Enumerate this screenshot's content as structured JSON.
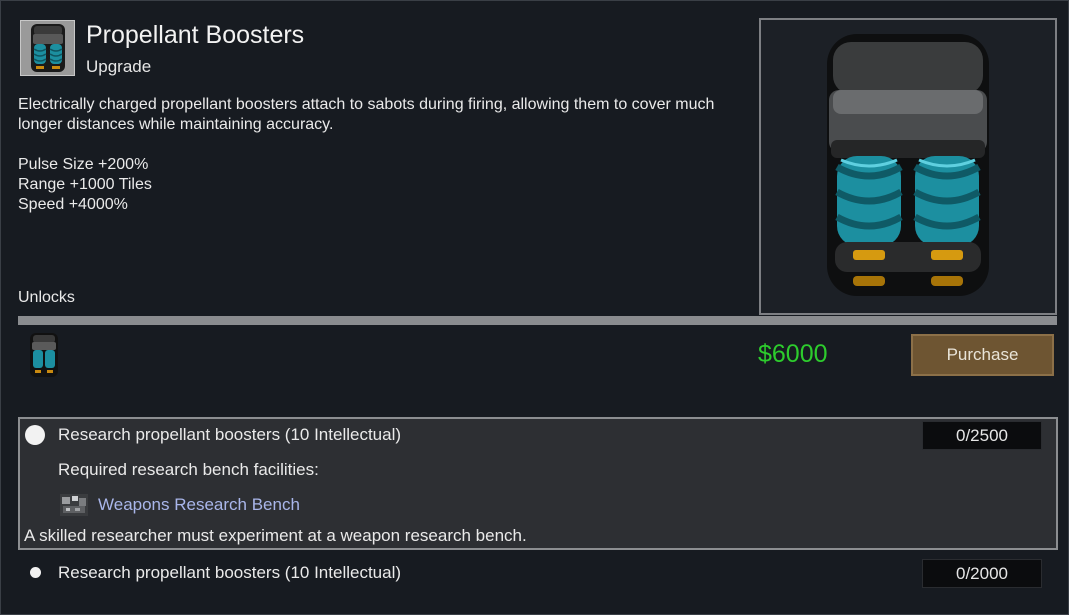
{
  "header": {
    "title": "Propellant Boosters",
    "subtitle": "Upgrade"
  },
  "description": "Electrically charged propellant boosters attach to sabots during firing, allowing them to cover much longer distances while maintaining accuracy.",
  "stats": [
    "Pulse Size +200%",
    "Range +1000 Tiles",
    "Speed +4000%"
  ],
  "unlocks_label": "Unlocks",
  "price": "$6000",
  "purchase_label": "Purchase",
  "requirements": [
    {
      "title": "Research propellant boosters (10 Intellectual)",
      "progress": "0/2500",
      "facilities_label": "Required research bench facilities:",
      "facility": "Weapons Research Bench",
      "note": "A skilled researcher must experiment at a weapon research bench."
    },
    {
      "title": "Research propellant boosters (10 Intellectual)",
      "progress": "0/2000"
    }
  ],
  "icons": {
    "item": "propellant-booster-icon",
    "bench": "research-bench-icon"
  },
  "colors": {
    "price": "#2dcc2d",
    "purchase_button": "#6e5532",
    "link": "#a9b6ea",
    "booster_teal": "#1c8fa0"
  }
}
